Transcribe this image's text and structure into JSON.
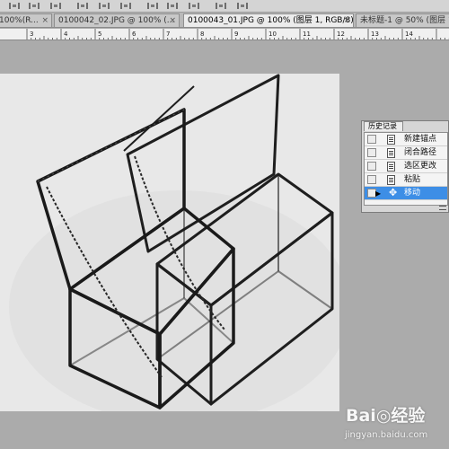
{
  "tabs": [
    {
      "title": "100%(R..."
    },
    {
      "title": "0100042_02.JPG @ 100% (..."
    },
    {
      "title": "0100043_01.JPG @ 100% (图层 1, RGB/8) *",
      "active": true
    },
    {
      "title": "未标题-1 @ 50% (图层 1..."
    }
  ],
  "tab_close_glyph": "×",
  "ruler": {
    "labels": [
      "3",
      "4",
      "5",
      "6",
      "7",
      "8",
      "9",
      "10",
      "11",
      "12",
      "13",
      "14"
    ]
  },
  "history_panel": {
    "title": "历史记录",
    "items": [
      {
        "label": "新建锚点",
        "selected": false
      },
      {
        "label": "闭合路径",
        "selected": false
      },
      {
        "label": "选区更改",
        "selected": false
      },
      {
        "label": "粘贴",
        "selected": false
      },
      {
        "label": "移动",
        "selected": true
      }
    ]
  },
  "watermark": {
    "logo": "Bai◎经验",
    "url": "jingyan.baidu.com"
  },
  "colors": {
    "selection": "#3d8ee6",
    "canvas_bg": "#e6e6e6",
    "workspace": "#ababab"
  }
}
